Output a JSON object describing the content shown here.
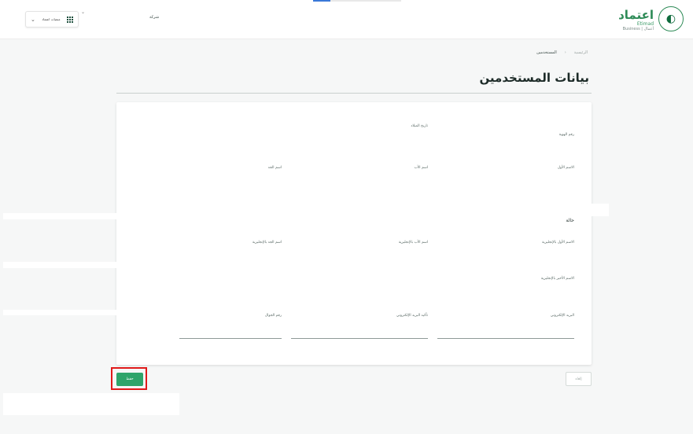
{
  "header": {
    "logo_ar": "اعتماد",
    "logo_en": "Etimad",
    "logo_sub": "Business | أعمال",
    "company_label": "شركة",
    "platform_label": "منصات اعتماد"
  },
  "breadcrumb": {
    "home": "الرئيسية",
    "current": "المستخدمين"
  },
  "page_title": "بيانات المستخدمين",
  "form": {
    "id_number_label": "رقم الهوية",
    "record_label": "تاريخ الميلاد",
    "first_name_label": "الاسم الأول",
    "father_name_label": "اسم الأب",
    "family_name_label": "اسم الجد",
    "status_label": "حالة",
    "first_name_native_label": "الاسم الأول بالإنجليزية",
    "father_name_native_label": "اسم الأب بالإنجليزية",
    "grand_name_native_label": "اسم الجد بالإنجليزية",
    "family_name_en_label": "الاسم الأخير بالإنجليزية",
    "email_label": "البريد الإلكتروني",
    "confirm_email_label": "تأكيد البريد الإلكتروني",
    "mobile_label": "رقم الجوال"
  },
  "actions": {
    "save_label": "حفظ",
    "cancel_label": "إلغاء"
  },
  "colors": {
    "primary": "#2fa46a",
    "highlight": "#e01a1a",
    "brand": "#2e8b57"
  }
}
